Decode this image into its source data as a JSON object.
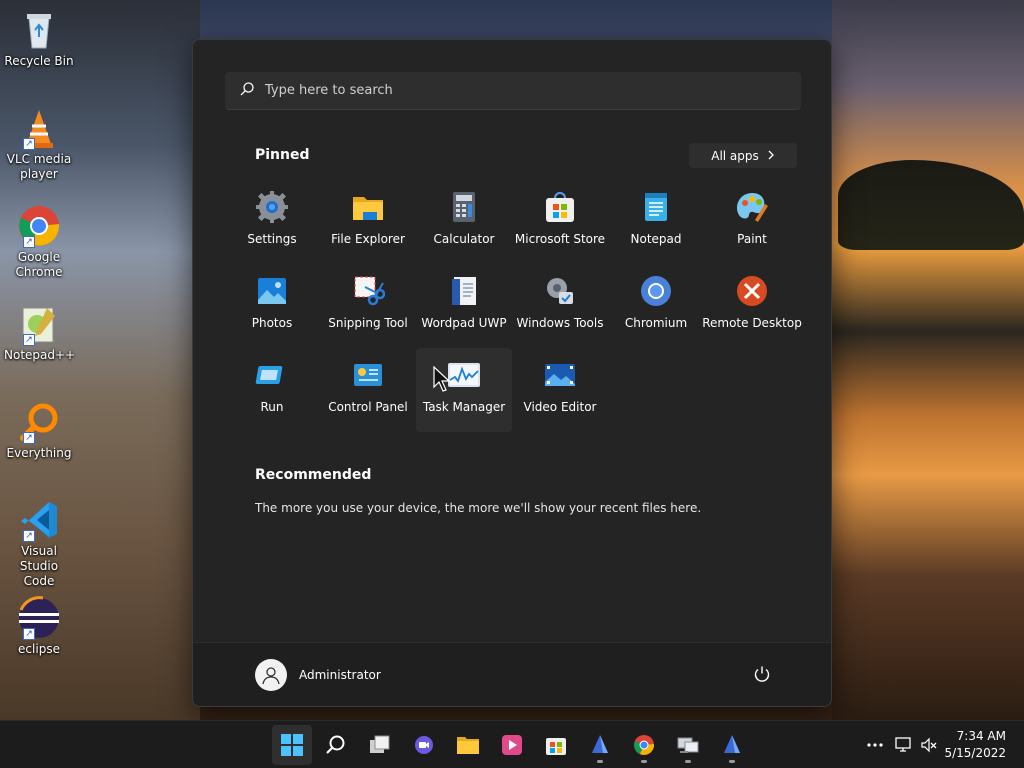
{
  "desktop": {
    "icons": [
      {
        "label": "Recycle Bin"
      },
      {
        "label": "VLC media player"
      },
      {
        "label": "Google Chrome"
      },
      {
        "label": "Notepad++"
      },
      {
        "label": "Everything"
      },
      {
        "label": "Visual Studio Code"
      },
      {
        "label": "eclipse"
      }
    ]
  },
  "start": {
    "search_placeholder": "Type here to search",
    "pinned_title": "Pinned",
    "all_apps_label": "All apps",
    "apps": [
      {
        "label": "Settings"
      },
      {
        "label": "File Explorer"
      },
      {
        "label": "Calculator"
      },
      {
        "label": "Microsoft Store"
      },
      {
        "label": "Notepad"
      },
      {
        "label": "Paint"
      },
      {
        "label": "Photos"
      },
      {
        "label": "Snipping Tool"
      },
      {
        "label": "Wordpad UWP"
      },
      {
        "label": "Windows Tools"
      },
      {
        "label": "Chromium"
      },
      {
        "label": "Remote Desktop"
      },
      {
        "label": "Run"
      },
      {
        "label": "Control Panel"
      },
      {
        "label": "Task Manager"
      },
      {
        "label": "Video Editor"
      }
    ],
    "recommended_title": "Recommended",
    "recommended_text": "The more you use your device, the more we'll show your recent files here.",
    "user_name": "Administrator"
  },
  "taskbar": {
    "time": "7:34 AM",
    "date": "5/15/2022"
  },
  "colors": {
    "start_bg": "#242424",
    "taskbar_bg": "#1c1c1c",
    "accent": "#0078d4"
  }
}
